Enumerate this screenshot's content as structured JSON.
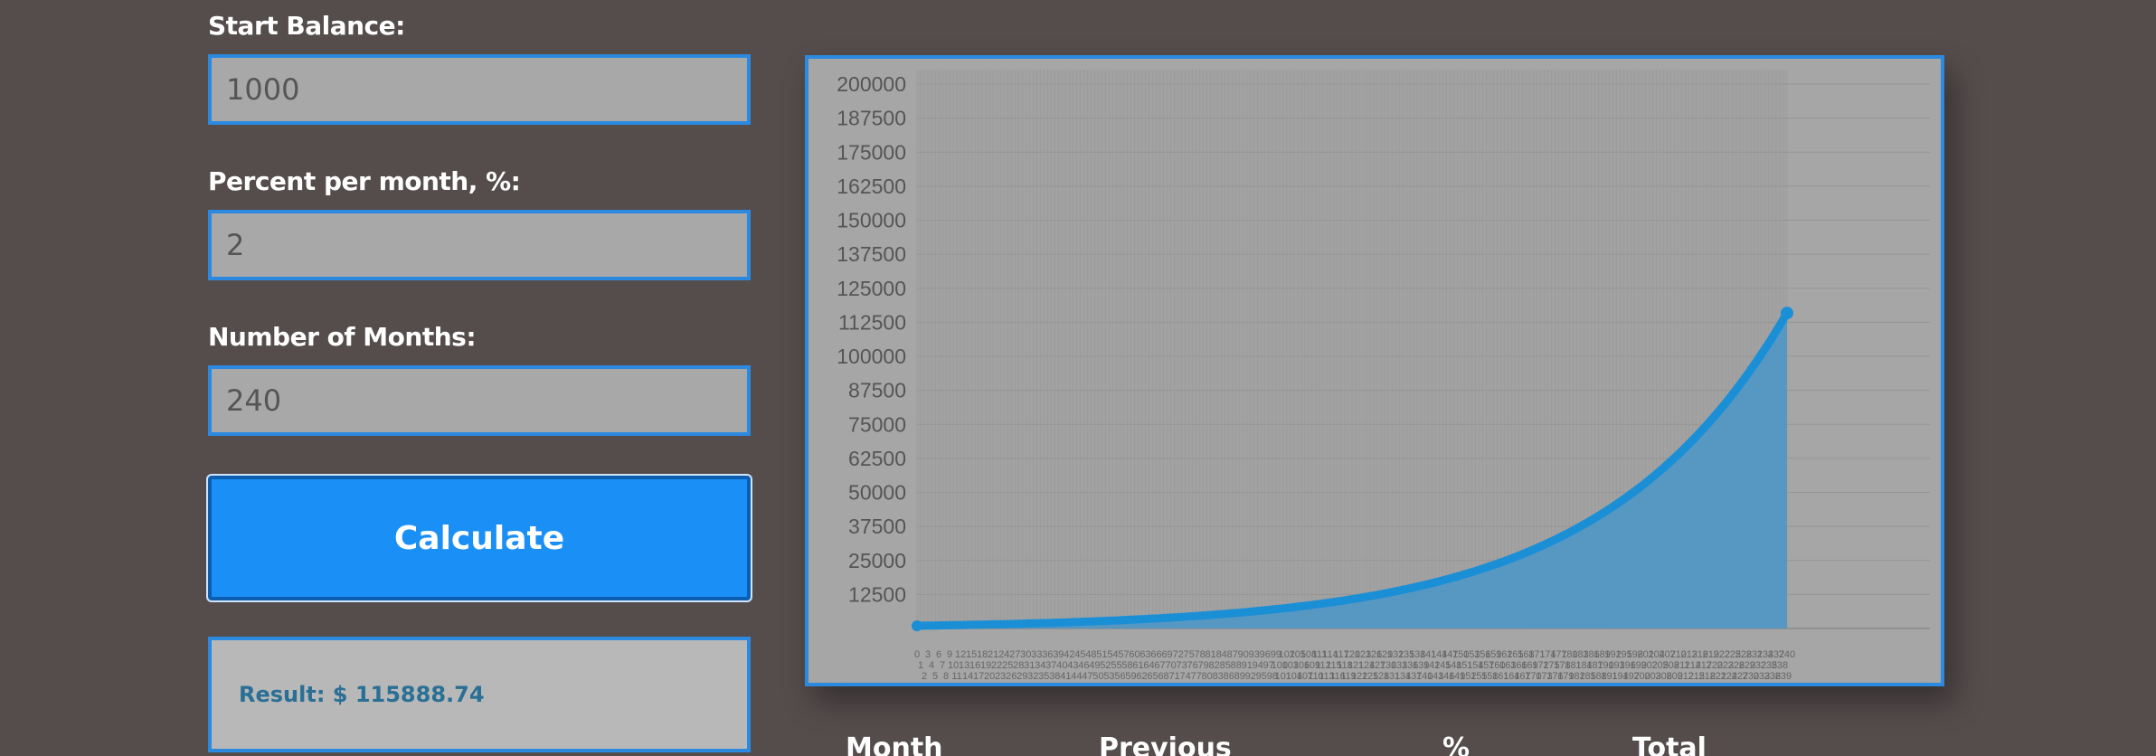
{
  "form": {
    "start_balance": {
      "label": "Start Balance:",
      "value": "1000"
    },
    "percent": {
      "label": "Percent per month, %:",
      "value": "2"
    },
    "months": {
      "label": "Number of Months:",
      "value": "240"
    },
    "calculate_label": "Calculate",
    "result_text": "Result: $ 115888.74"
  },
  "table": {
    "headers": [
      "Month",
      "Previous",
      "%",
      "Total"
    ]
  },
  "colors": {
    "accent": "#1a8ff5",
    "line": "#1b8fd6",
    "area": "#4a97c9",
    "background": "#554c4c"
  },
  "chart_data": {
    "type": "area",
    "title": "",
    "xlabel": "",
    "ylabel": "",
    "ylim": [
      0,
      200000
    ],
    "y_ticks": [
      12500,
      25000,
      37500,
      50000,
      62500,
      75000,
      87500,
      100000,
      112500,
      125000,
      137500,
      150000,
      162500,
      175000,
      187500,
      200000
    ],
    "x_range": [
      0,
      240
    ],
    "series": [
      {
        "start_balance": 1000,
        "monthly_rate_percent": 2,
        "months": 240,
        "final_value": 115888.74
      }
    ],
    "grid": true,
    "legend": "none"
  }
}
